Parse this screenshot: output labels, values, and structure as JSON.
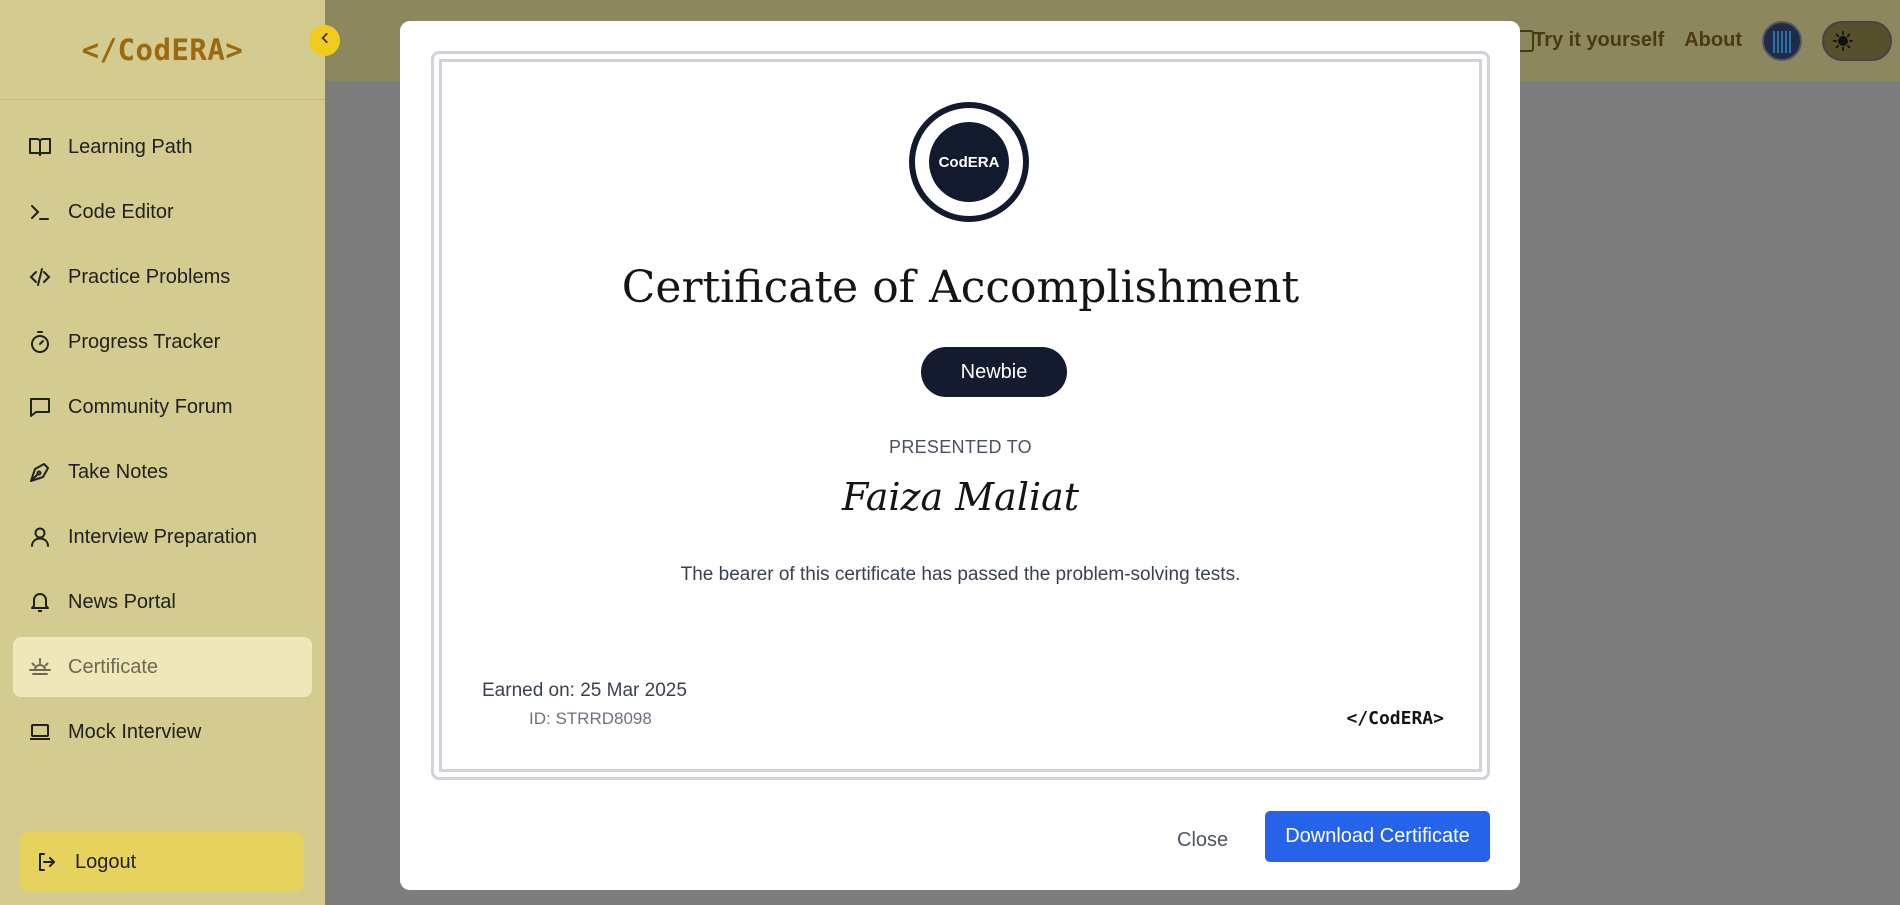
{
  "app": {
    "logo": "</CodERA>",
    "colors": {
      "sidebar": "#d3cb8f",
      "active": "#efe7ba",
      "logout": "#e6d25e",
      "brand": "#9a6910",
      "primary": "#2563eb",
      "dark": "#121a2e"
    }
  },
  "sidebar": {
    "items": [
      {
        "label": "Learning Path",
        "icon": "book-open-icon"
      },
      {
        "label": "Code Editor",
        "icon": "terminal-icon"
      },
      {
        "label": "Practice Problems",
        "icon": "code-icon"
      },
      {
        "label": "Progress Tracker",
        "icon": "timer-icon"
      },
      {
        "label": "Community Forum",
        "icon": "message-square-icon"
      },
      {
        "label": "Take Notes",
        "icon": "pen-tool-icon"
      },
      {
        "label": "Interview Preparation",
        "icon": "user-icon"
      },
      {
        "label": "News Portal",
        "icon": "bell-icon"
      },
      {
        "label": "Certificate",
        "icon": "sunrise-icon",
        "active": true
      },
      {
        "label": "Mock Interview",
        "icon": "laptop-icon"
      }
    ],
    "logout_label": "Logout"
  },
  "topbar": {
    "links": [
      "Try it yourself",
      "About"
    ]
  },
  "certificate": {
    "badge_text": "CodERA",
    "title": "Certificate of Accomplishment",
    "level": "Newbie",
    "presented_label": "PRESENTED TO",
    "recipient": "Faiza Maliat",
    "statement": "The bearer of this certificate has passed the problem-solving tests.",
    "earned_on": "Earned on: 25 Mar 2025",
    "id": "ID: STRRD8098",
    "brand_mark": "</CodERA>"
  },
  "modal": {
    "close_label": "Close",
    "download_label": "Download Certificate"
  }
}
